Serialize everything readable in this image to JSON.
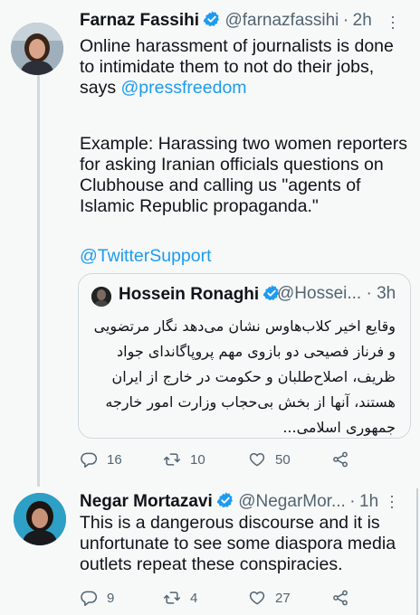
{
  "tweet1": {
    "author_name": "Farnaz Fassihi",
    "handle": "@farnazfassihi",
    "separator": "·",
    "time": "2h",
    "text_line_1a": "Online harassment of journalists is done to intimidate them to not do their jobs, says ",
    "mention": "@pressfreedom",
    "text_line_2": "Example: Harassing two women reporters for asking Iranian officials questions on Clubhouse and calling us \"agents of Islamic Republic propaganda.\"",
    "mention_support": "@TwitterSupport",
    "quote": {
      "author_name": "Hossein Ronaghi",
      "handle": "@Hossei...",
      "separator": "·",
      "time": "3h",
      "text": "وقایع اخیر کلاب‌هاوس نشان می‌دهد نگار مرتضویی و فرناز فصیحی دو بازوی مهم پروپاگاندای جواد ظریف، اصلاح‌طلبان و حکومت در خارج از ایران هستند، آنها از بخش بی‌حجاب وزارت امور خارجه جمهوری اسلامی..."
    },
    "actions": {
      "replies": "16",
      "retweets": "10",
      "likes": "50"
    }
  },
  "tweet2": {
    "author_name": "Negar Mortazavi",
    "handle": "@NegarMor...",
    "separator": "·",
    "time": "1h",
    "text": "This is a dangerous discourse and it is unfortunate to see some diaspora media outlets repeat these conspiracies.",
    "actions": {
      "replies": "9",
      "retweets": "4",
      "likes": "27"
    }
  },
  "colors": {
    "verified": "#1d9bf0",
    "link": "#1d9bf0",
    "muted": "#536471",
    "background": "#f7f9f9"
  },
  "icons": [
    "verified-badge-icon",
    "more-options-icon",
    "reply-icon",
    "retweet-icon",
    "like-icon",
    "share-icon"
  ]
}
